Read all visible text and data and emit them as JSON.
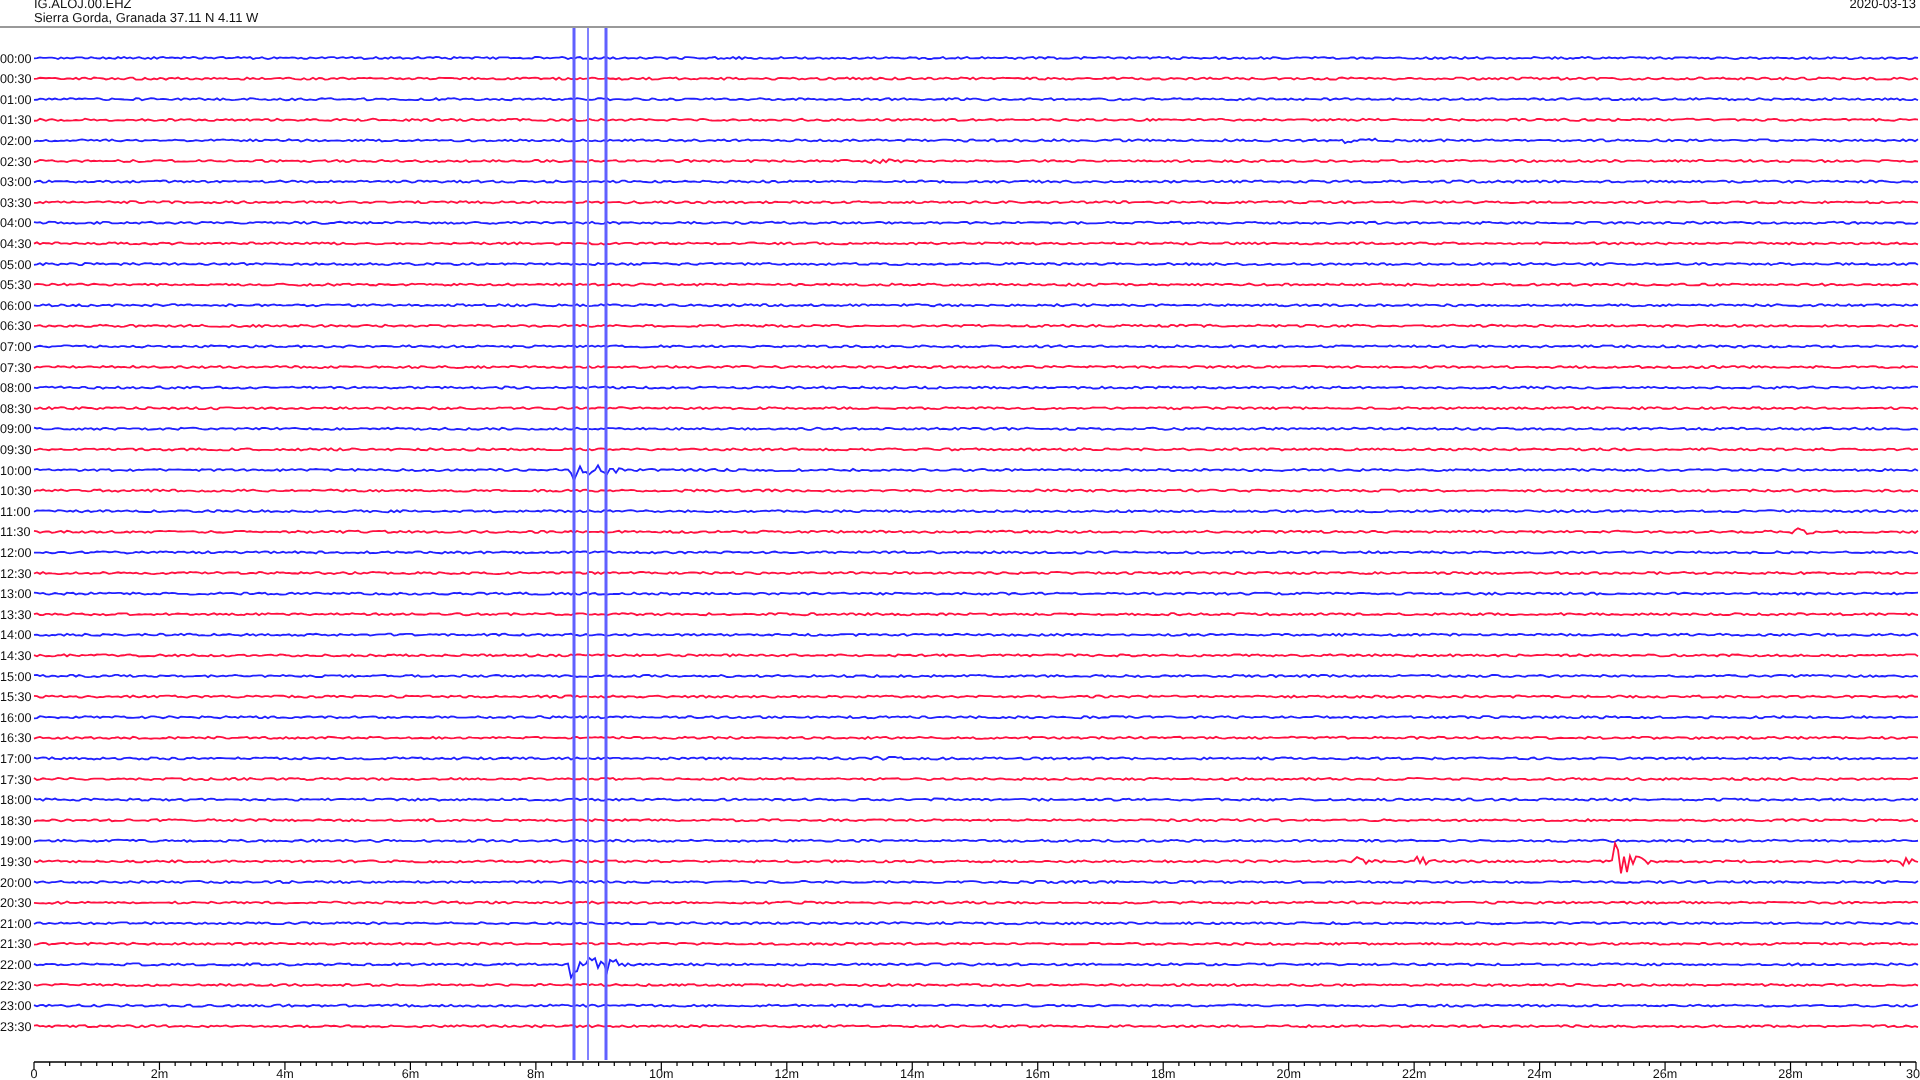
{
  "header": {
    "station": "IG.ALOJ.00.EHZ",
    "location": "Sierra Gorda, Granada  37.11 N 4.11 W",
    "date": "2020-03-13"
  },
  "traces": [
    {
      "label": "00:00",
      "color": "#2020ff"
    },
    {
      "label": "00:30",
      "color": "#ff1040"
    },
    {
      "label": "01:00",
      "color": "#2020ff"
    },
    {
      "label": "01:30",
      "color": "#ff1040"
    },
    {
      "label": "02:00",
      "color": "#2020ff"
    },
    {
      "label": "02:30",
      "color": "#ff1040"
    },
    {
      "label": "03:00",
      "color": "#2020ff"
    },
    {
      "label": "03:30",
      "color": "#ff1040"
    },
    {
      "label": "04:00",
      "color": "#2020ff"
    },
    {
      "label": "04:30",
      "color": "#ff1040"
    },
    {
      "label": "05:00",
      "color": "#2020ff"
    },
    {
      "label": "05:30",
      "color": "#ff1040"
    },
    {
      "label": "06:00",
      "color": "#2020ff"
    },
    {
      "label": "06:30",
      "color": "#ff1040"
    },
    {
      "label": "07:00",
      "color": "#2020ff"
    },
    {
      "label": "07:30",
      "color": "#ff1040"
    },
    {
      "label": "08:00",
      "color": "#2020ff"
    },
    {
      "label": "08:30",
      "color": "#ff1040"
    },
    {
      "label": "09:00",
      "color": "#2020ff"
    },
    {
      "label": "09:30",
      "color": "#ff1040"
    },
    {
      "label": "10:00",
      "color": "#2020ff"
    },
    {
      "label": "10:30",
      "color": "#ff1040"
    },
    {
      "label": "11:00",
      "color": "#2020ff"
    },
    {
      "label": "11:30",
      "color": "#ff1040"
    },
    {
      "label": "12:00",
      "color": "#2020ff"
    },
    {
      "label": "12:30",
      "color": "#ff1040"
    },
    {
      "label": "13:00",
      "color": "#2020ff"
    },
    {
      "label": "13:30",
      "color": "#ff1040"
    },
    {
      "label": "14:00",
      "color": "#2020ff"
    },
    {
      "label": "14:30",
      "color": "#ff1040"
    },
    {
      "label": "15:00",
      "color": "#2020ff"
    },
    {
      "label": "15:30",
      "color": "#ff1040"
    },
    {
      "label": "16:00",
      "color": "#2020ff"
    },
    {
      "label": "16:30",
      "color": "#ff1040"
    },
    {
      "label": "17:00",
      "color": "#2020ff"
    },
    {
      "label": "17:30",
      "color": "#ff1040"
    },
    {
      "label": "18:00",
      "color": "#2020ff"
    },
    {
      "label": "18:30",
      "color": "#ff1040"
    },
    {
      "label": "19:00",
      "color": "#2020ff"
    },
    {
      "label": "19:30",
      "color": "#ff1040"
    },
    {
      "label": "20:00",
      "color": "#2020ff"
    },
    {
      "label": "20:30",
      "color": "#ff1040"
    },
    {
      "label": "21:00",
      "color": "#2020ff"
    },
    {
      "label": "21:30",
      "color": "#ff1040"
    },
    {
      "label": "22:00",
      "color": "#2020ff"
    },
    {
      "label": "22:30",
      "color": "#ff1040"
    },
    {
      "label": "23:00",
      "color": "#2020ff"
    },
    {
      "label": "23:30",
      "color": "#ff1040"
    }
  ],
  "axis_labels": [
    "0",
    "2m",
    "4m",
    "6m",
    "8m",
    "10m",
    "12m",
    "14m",
    "16m",
    "18m",
    "20m",
    "22m",
    "24m",
    "26m",
    "28m",
    "30"
  ]
}
